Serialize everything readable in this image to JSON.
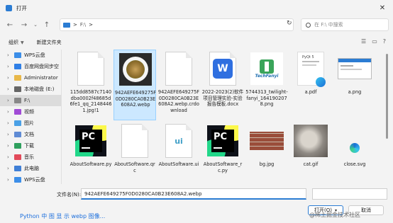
{
  "title": "打开",
  "address": {
    "drive": "F:\\",
    "arrow": ">"
  },
  "search": {
    "placeholder": "在 F:\\ 中搜索"
  },
  "toolbar": {
    "organize": "组织",
    "new_folder": "新建文件夹"
  },
  "sidebar": {
    "items": [
      {
        "label": "WPS云盘",
        "icon_color": "#3c8ee8"
      },
      {
        "label": "百度网盘同步空",
        "icon_color": "#2f7fe6"
      },
      {
        "label": "Administrator",
        "icon_color": "#e8b84a"
      },
      {
        "label": "本地磁盘 (E:)",
        "icon_color": "#666666"
      },
      {
        "label": "F:\\",
        "icon_color": "#888888"
      },
      {
        "label": "视频",
        "icon_color": "#a14bd6"
      },
      {
        "label": "图片",
        "icon_color": "#4aa0e6"
      },
      {
        "label": "文档",
        "icon_color": "#5f8bd4"
      },
      {
        "label": "下载",
        "icon_color": "#2fa05e"
      },
      {
        "label": "音乐",
        "icon_color": "#e24a5a"
      },
      {
        "label": "此电脑",
        "icon_color": "#3f7fd6"
      },
      {
        "label": "WPS云盘",
        "icon_color": "#3c8ee8"
      }
    ]
  },
  "files": [
    {
      "name": "115dd8587c7140dba0002f48685d6fe1_qq_21484461.jpg!1",
      "icon": "blank-doc"
    },
    {
      "name": "942AEFE649275F0D0280CA0B23E608A2.webp",
      "icon": "food-photo"
    },
    {
      "name": "942AEFE649275F0D0280CA0B23E608A2.webp.crdownload",
      "icon": "blank-doc"
    },
    {
      "name": "2022-2023(2)软件项目管理实验-实验报告模板.docx",
      "icon": "wps-doc"
    },
    {
      "name": "5744313_twilight-fanyi_1641902078.png",
      "icon": "techfanyi-logo"
    },
    {
      "name": "a.pdf",
      "icon": "pdf-page"
    },
    {
      "name": "a.png",
      "icon": "screenshot-thumb"
    },
    {
      "name": "AboutSoftware.py",
      "icon": "pycharm"
    },
    {
      "name": "AboutSoftware.qrc",
      "icon": "blank-doc"
    },
    {
      "name": "AboutSoftware.ui",
      "icon": "ui-doc"
    },
    {
      "name": "AboutSoftware_rc.py",
      "icon": "pycharm"
    },
    {
      "name": "bg.jpg",
      "icon": "brick-photo"
    },
    {
      "name": "cat.gif",
      "icon": "cat-photo"
    },
    {
      "name": "close.svg",
      "icon": "edge-logo"
    }
  ],
  "thumb_texts": {
    "techfanyi": "TechFanyi",
    "pyqt": "PyQt 5",
    "pcicon": "PC",
    "ui": "ui"
  },
  "bottom": {
    "filename_label": "文件名(N):",
    "filename_value": "942AEFE649275F0D0280CA0B23E608A2.webp",
    "open_label": "打开(O)",
    "cancel_label": "取消"
  },
  "behind_text": "Python 中 图 显 示 webp 图像...",
  "watermark": "@稀土掘金技术社区",
  "colors": {
    "accent": "#2b7cd3",
    "selection": "#cce8ff"
  }
}
